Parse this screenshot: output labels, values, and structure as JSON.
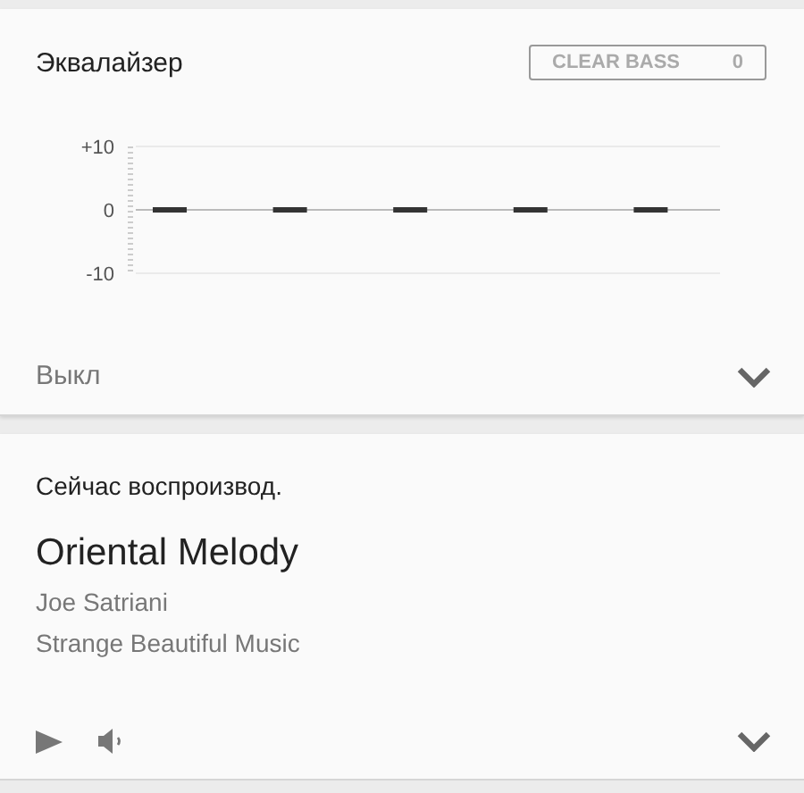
{
  "equalizer": {
    "title": "Эквалайзер",
    "clear_bass": {
      "label": "CLEAR BASS",
      "value": "0"
    },
    "chart_data": {
      "type": "bar",
      "values": [
        0,
        0,
        0,
        0,
        0
      ],
      "ylim": [
        -10,
        10
      ],
      "yticks": [
        {
          "value": 10,
          "label": "+10"
        },
        0,
        {
          "value": -10,
          "label": "-10"
        }
      ]
    },
    "preset": "Выкл"
  },
  "now_playing": {
    "heading": "Сейчас воспроизвод.",
    "title": "Oriental Melody",
    "artist": "Joe Satriani",
    "album": "Strange Beautiful Music"
  }
}
